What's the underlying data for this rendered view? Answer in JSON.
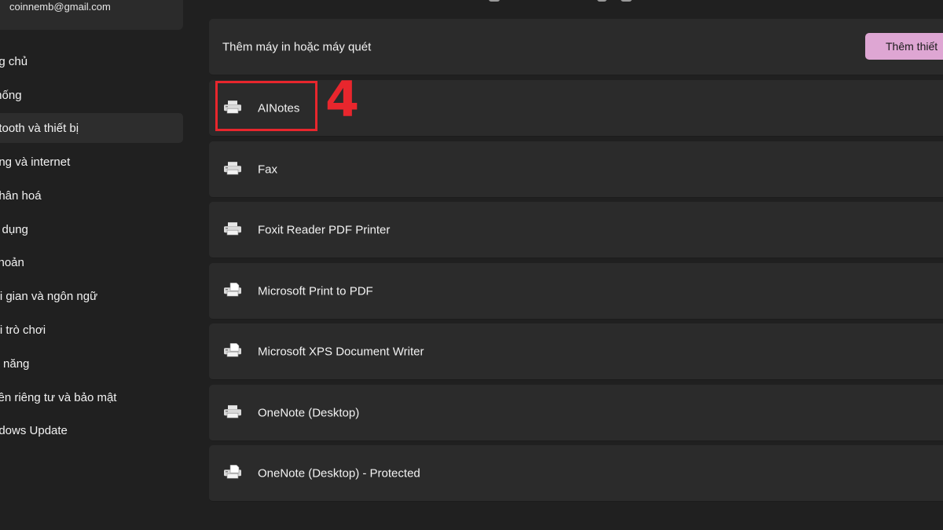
{
  "account": {
    "email": "coinnemb@gmail.com"
  },
  "sidebar": {
    "items": [
      {
        "label": "ng chủ",
        "active": false
      },
      {
        "label": " thống",
        "active": false
      },
      {
        "label": "etooth và thiết bị",
        "active": true
      },
      {
        "label": "ang và internet",
        "active": false
      },
      {
        "label": " nhân hoá",
        "active": false
      },
      {
        "label": "g dụng",
        "active": false
      },
      {
        "label": " khoản",
        "active": false
      },
      {
        "label": "ời gian và ngôn ngữ",
        "active": false
      },
      {
        "label": "ơi trò chơi",
        "active": false
      },
      {
        "label": "ợ năng",
        "active": false
      },
      {
        "label": "yền riêng tư và bảo mật",
        "active": false
      },
      {
        "label": "ndows Update",
        "active": false
      }
    ]
  },
  "main": {
    "add_printer": {
      "label": "Thêm máy in hoặc máy quét",
      "button_label": "Thêm thiết"
    },
    "printers": [
      {
        "name": "AINotes",
        "icon": "printer-icon"
      },
      {
        "name": "Fax",
        "icon": "printer-icon"
      },
      {
        "name": "Foxit Reader PDF Printer",
        "icon": "printer-icon"
      },
      {
        "name": "Microsoft Print to PDF",
        "icon": "printer-document-icon"
      },
      {
        "name": "Microsoft XPS Document Writer",
        "icon": "printer-document-icon"
      },
      {
        "name": "OneNote (Desktop)",
        "icon": "printer-icon"
      },
      {
        "name": "OneNote (Desktop) - Protected",
        "icon": "printer-document-icon"
      }
    ]
  },
  "annotation": {
    "step_number": "4",
    "color": "#e8262d"
  },
  "colors": {
    "background": "#202020",
    "card": "#2b2b2b",
    "accent_button": "#dea6d3"
  }
}
